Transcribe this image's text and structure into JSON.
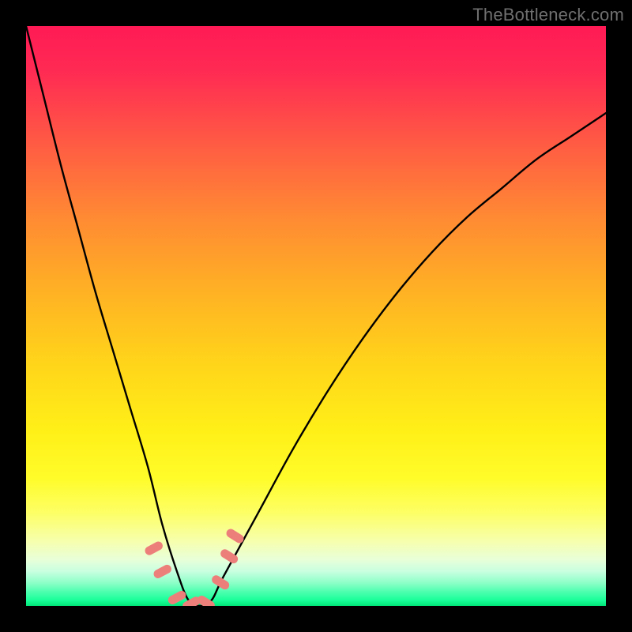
{
  "watermark": "TheBottleneck.com",
  "colors": {
    "frame": "#000000",
    "curve_stroke": "#000000",
    "marker_fill": "#ed7f7b",
    "gradient_stops": [
      "#ff1a55",
      "#ff2b53",
      "#ff5a44",
      "#ff8a33",
      "#ffb224",
      "#ffd41a",
      "#fff018",
      "#fffc2a",
      "#fdff66",
      "#f6ffb0",
      "#e8ffd8",
      "#c9ffe0",
      "#8effc8",
      "#4fffb0",
      "#1aff99",
      "#00e57a"
    ]
  },
  "chart_data": {
    "type": "line",
    "title": "",
    "xlabel": "",
    "ylabel": "",
    "xlim": [
      0,
      100
    ],
    "ylim": [
      0,
      100
    ],
    "note": "Curve is a V-shaped bottleneck profile; y values are percent height read from the image (0 = bottom green band, 100 = top red).",
    "series": [
      {
        "name": "bottleneck-curve",
        "x": [
          0,
          3,
          6,
          9,
          12,
          15,
          18,
          21,
          23.5,
          26,
          28,
          30,
          32,
          34,
          40,
          46,
          52,
          58,
          64,
          70,
          76,
          82,
          88,
          94,
          100
        ],
        "values": [
          100,
          88,
          76,
          65,
          54,
          44,
          34,
          24,
          14,
          6,
          1,
          0,
          1,
          5,
          16,
          27,
          37,
          46,
          54,
          61,
          67,
          72,
          77,
          81,
          85
        ]
      }
    ],
    "markers": [
      {
        "name": "left-descent-1",
        "x": 22.0,
        "y": 10.0
      },
      {
        "name": "left-descent-2",
        "x": 23.5,
        "y": 6.0
      },
      {
        "name": "trough-left",
        "x": 26.0,
        "y": 1.5
      },
      {
        "name": "trough-mid",
        "x": 28.5,
        "y": 0.5
      },
      {
        "name": "trough-right",
        "x": 31.0,
        "y": 0.5
      },
      {
        "name": "right-rise-1",
        "x": 33.5,
        "y": 4.0
      },
      {
        "name": "right-rise-2",
        "x": 35.0,
        "y": 8.5
      },
      {
        "name": "right-rise-3",
        "x": 36.0,
        "y": 12.0
      }
    ]
  }
}
